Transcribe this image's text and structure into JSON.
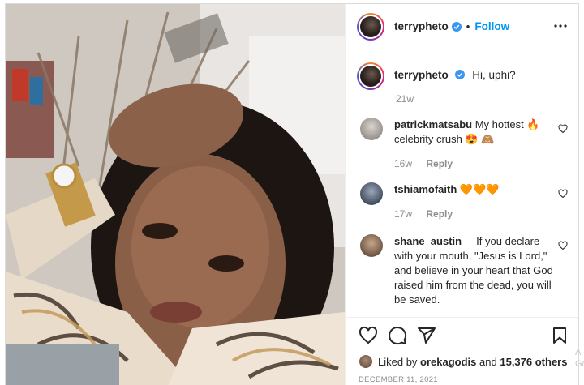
{
  "header": {
    "username": "terrypheto",
    "separator": "•",
    "follow_label": "Follow"
  },
  "caption": {
    "username": "terrypheto",
    "text": "Hi, uphi?",
    "time": "21w"
  },
  "comments": [
    {
      "username": "patrickmatsabu",
      "text": "My hottest 🔥 celebrity crush 😍 🙈",
      "time": "16w",
      "reply_label": "Reply"
    },
    {
      "username": "tshiamofaith",
      "text": "🧡🧡🧡",
      "time": "17w",
      "reply_label": "Reply"
    },
    {
      "username": "shane_austin__",
      "text": "If you declare with your mouth, \"Jesus is Lord,\" and believe in your heart that God raised him from the dead, you will be saved."
    }
  ],
  "likes": {
    "prefix": "Liked by",
    "user": "orekagodis",
    "middle": "and",
    "count": "15,376 others"
  },
  "date": "DECEMBER 11, 2021",
  "edge_fragments": [
    "A",
    "Go"
  ],
  "colors": {
    "follow": "#0095f6",
    "verified": "#3897f0",
    "muted": "#8e8e8e",
    "text": "#262626"
  },
  "icons": {
    "more": "more-options-icon",
    "verified": "verified-badge-icon",
    "like": "heart-icon",
    "comment": "comment-icon",
    "share": "share-icon",
    "save": "bookmark-icon"
  }
}
